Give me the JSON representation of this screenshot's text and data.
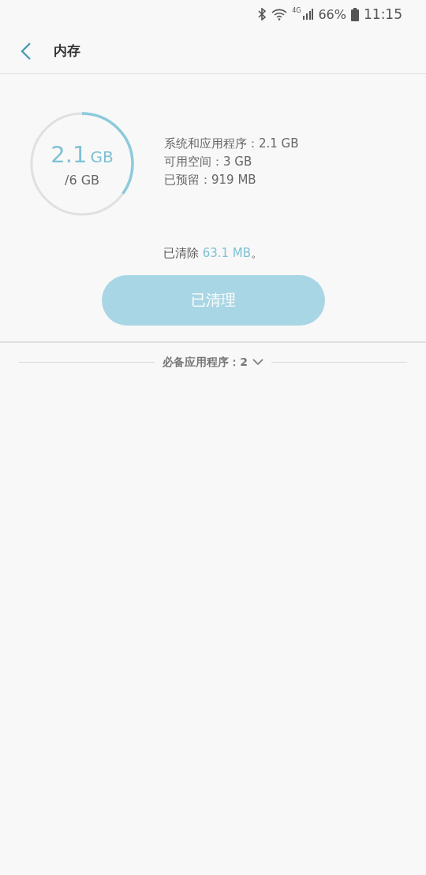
{
  "status_bar": {
    "battery": "66%",
    "time": "11:15",
    "network": "4G"
  },
  "header": {
    "title": "内存"
  },
  "memory": {
    "used": "2.1",
    "used_unit": "GB",
    "total": "/6 GB",
    "level": 0.35,
    "details": [
      "系统和应用程序：2.1 GB",
      "可用空间：3 GB",
      "已预留：919 MB"
    ]
  },
  "cleared": {
    "prefix": "已清除 ",
    "amount": "63.1 MB",
    "suffix": "。"
  },
  "clean_button": {
    "label": "已清理",
    "disabled": true
  },
  "essential_apps": {
    "label": "必备应用程序：2",
    "expanded": false
  }
}
